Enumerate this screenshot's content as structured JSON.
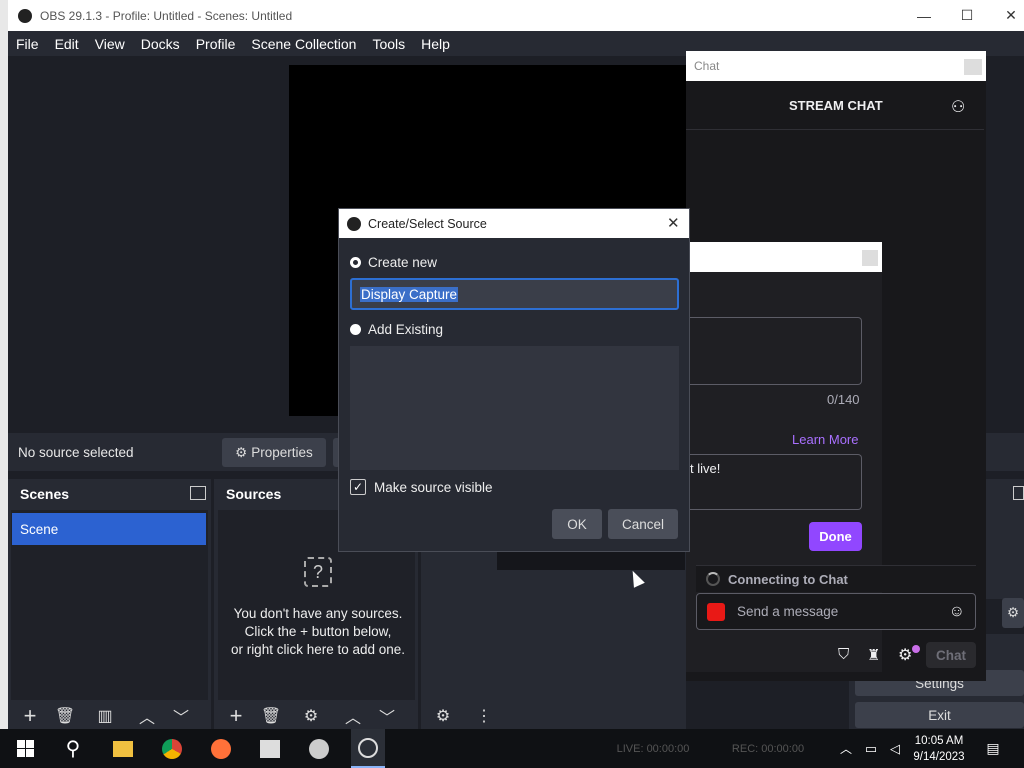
{
  "window": {
    "title": "OBS 29.1.3 - Profile: Untitled - Scenes: Untitled",
    "minimize": "—",
    "maximize": "☐",
    "close": "✕"
  },
  "menu": [
    "File",
    "Edit",
    "View",
    "Docks",
    "Profile",
    "Scene Collection",
    "Tools",
    "Help"
  ],
  "source_bar": {
    "status": "No source selected",
    "properties": "Properties"
  },
  "scenes": {
    "title": "Scenes",
    "items": [
      "Scene"
    ]
  },
  "sources": {
    "title": "Sources",
    "empty_line1": "You don't have any sources.",
    "empty_line2": "Click the + button below,",
    "empty_line3": "or right click here to add one."
  },
  "dialog": {
    "title": "Create/Select Source",
    "create_new": "Create new",
    "name_value": "Display Capture",
    "add_existing": "Add Existing",
    "make_visible": "Make source visible",
    "make_visible_checked": true,
    "ok": "OK",
    "cancel": "Cancel"
  },
  "chat": {
    "dock_title": "Chat",
    "header": "STREAM CHAT",
    "counter": "0/140",
    "learn_more": "Learn More",
    "partial_text": "t live!",
    "done": "Done",
    "connecting": "Connecting to Chat",
    "send_placeholder": "Send a message",
    "chat_button": "Chat"
  },
  "controls": {
    "settings": "Settings",
    "exit": "Exit"
  },
  "status": {
    "live": "LIVE: 00:00:00",
    "rec": "REC: 00:00:00"
  },
  "clock": {
    "time": "10:05 AM",
    "date": "9/14/2023"
  },
  "colors": {
    "accent_blue": "#2d6fd3",
    "twitch_purple": "#9147ff",
    "dock_bg": "#272a33"
  }
}
